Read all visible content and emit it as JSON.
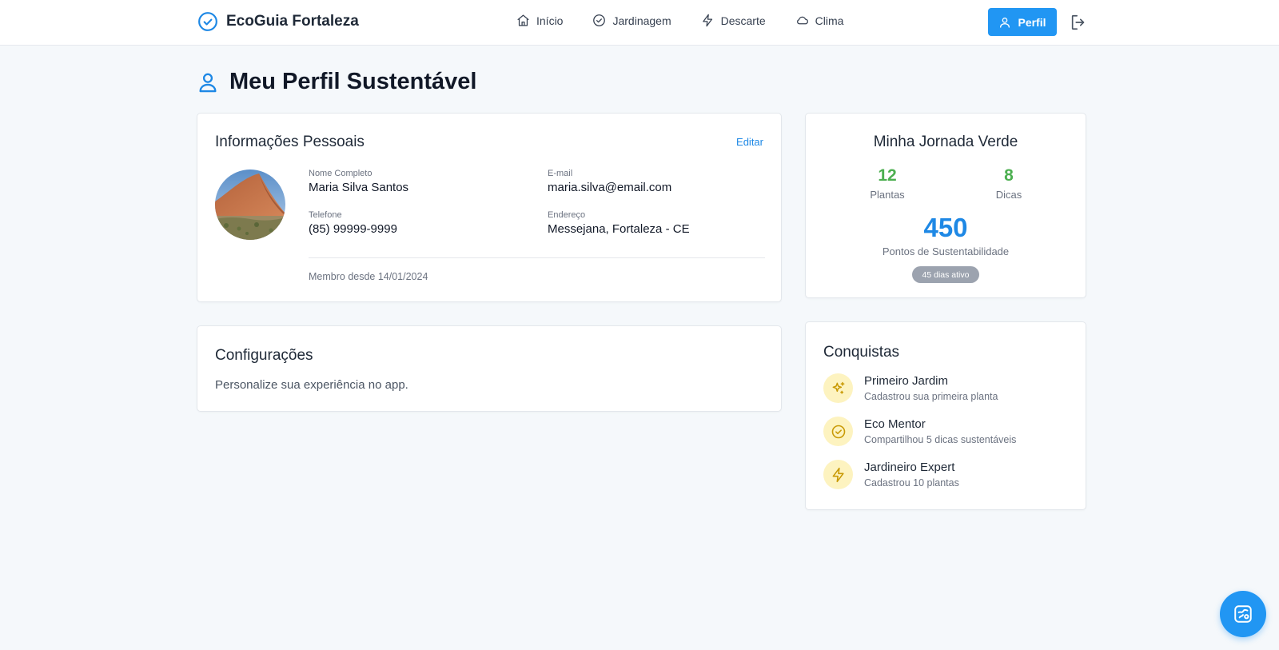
{
  "header": {
    "brand": "EcoGuia Fortaleza",
    "nav": [
      {
        "label": "Início",
        "icon": "home-icon"
      },
      {
        "label": "Jardinagem",
        "icon": "check-circle-icon"
      },
      {
        "label": "Descarte",
        "icon": "lightning-icon"
      },
      {
        "label": "Clima",
        "icon": "cloud-icon"
      }
    ],
    "profile_label": "Perfil"
  },
  "page": {
    "title": "Meu Perfil Sustentável"
  },
  "personal": {
    "title": "Informações Pessoais",
    "edit_label": "Editar",
    "name_label": "Nome Completo",
    "name": "Maria Silva Santos",
    "email_label": "E-mail",
    "email": "maria.silva@email.com",
    "phone_label": "Telefone",
    "phone": "(85) 99999-9999",
    "address_label": "Endereço",
    "address": "Messejana, Fortaleza - CE",
    "member_since": "Membro desde 14/01/2024"
  },
  "settings": {
    "title": "Configurações",
    "description": "Personalize sua experiência no app."
  },
  "journey": {
    "title": "Minha Jornada Verde",
    "plants_count": "12",
    "plants_label": "Plantas",
    "tips_count": "8",
    "tips_label": "Dicas",
    "points": "450",
    "points_label": "Pontos de Sustentabilidade",
    "active_badge": "45 dias ativo"
  },
  "achievements": {
    "title": "Conquistas",
    "items": [
      {
        "name": "Primeiro Jardim",
        "desc": "Cadastrou sua primeira planta",
        "icon": "sparkles-icon"
      },
      {
        "name": "Eco Mentor",
        "desc": "Compartilhou 5 dicas sustentáveis",
        "icon": "check-circle-icon"
      },
      {
        "name": "Jardineiro Expert",
        "desc": "Cadastrou 10 plantas",
        "icon": "lightning-icon"
      }
    ]
  },
  "colors": {
    "primary": "#2196f3",
    "green": "#4caf50",
    "badge_bg": "#fdf3c0",
    "icon_gold": "#c99a06"
  }
}
